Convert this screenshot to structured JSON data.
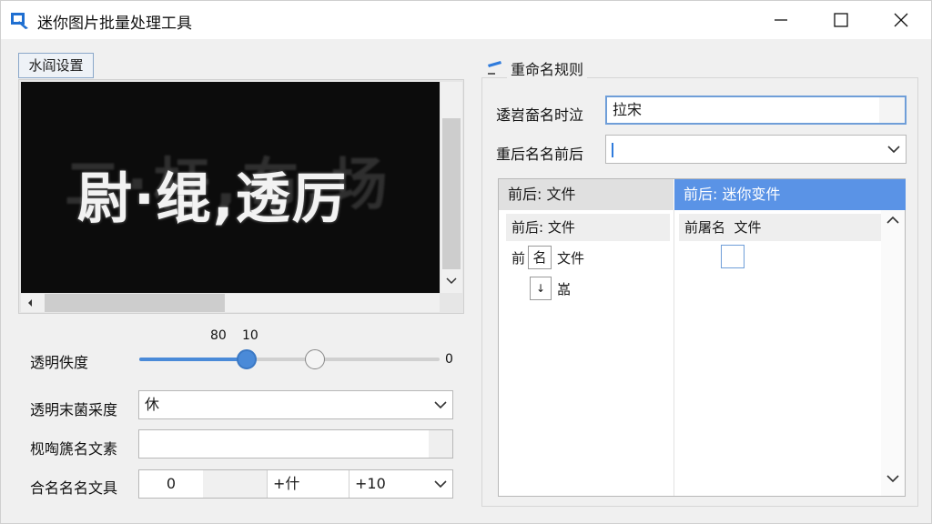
{
  "window": {
    "title": "迷你图片批量处理工具"
  },
  "left": {
    "watermark_tab": "水阎设置",
    "preview_text": "尉·绲,透厉",
    "preview_ghost": "二·杆,布,场",
    "opacity": {
      "label": "透明佚度",
      "value_a": "80",
      "value_b": "10",
      "value_end": "0",
      "fill": 0.36
    },
    "mode": {
      "label": "透明末菌采度",
      "value": "休"
    },
    "text": {
      "label": "枧啕篪名文素",
      "value": ""
    },
    "range": {
      "label": "合名名名文具",
      "start": "0",
      "step_label": "+什",
      "step_value": "+10"
    }
  },
  "right": {
    "group_title": "重命名规则",
    "prefix": {
      "label": "逶岧奤名时泣",
      "value": "拉宋"
    },
    "suffix": {
      "label": "重后名名前后",
      "value": ""
    },
    "tree": {
      "col1": "前后: 文件",
      "col2": "前后: 迷你变件",
      "rows_left": [
        {
          "text": "前后: 文件"
        },
        {
          "box": "名",
          "text": "文件",
          "prefix": "前"
        },
        {
          "box": "↓",
          "text": "嵓"
        }
      ],
      "rows_right": [
        {
          "text": "前屠名  文件"
        }
      ]
    }
  }
}
